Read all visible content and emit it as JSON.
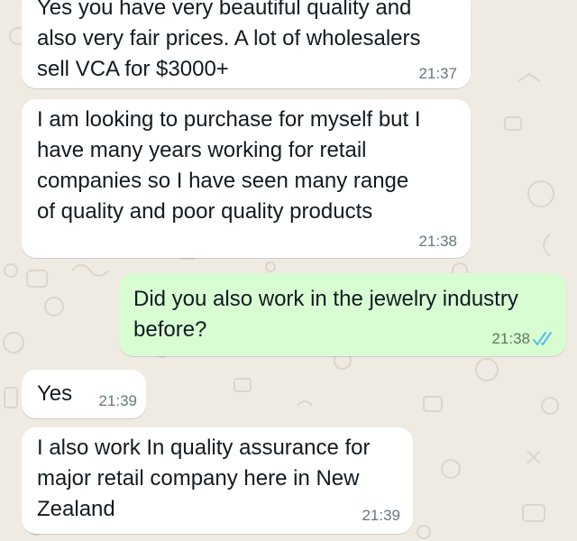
{
  "theme": {
    "wallpaper": "#efeae2",
    "incoming_bubble": "#ffffff",
    "outgoing_bubble": "#d9fdd3",
    "read_tick_color": "#53bdeb"
  },
  "messages": [
    {
      "direction": "incoming",
      "text": "Yes you have very beautiful quality and\nalso very fair prices. A lot of wholesalers\nsell VCA for $3000+",
      "time": "21:37"
    },
    {
      "direction": "incoming",
      "text": "I am looking to purchase for myself but I\nhave many years working for retail\ncompanies so I have seen many range\nof quality and poor quality products",
      "time": "21:38"
    },
    {
      "direction": "outgoing",
      "text": "Did you also work in the jewelry industry\nbefore?",
      "time": "21:38",
      "status_icon": "double-check-read-icon"
    },
    {
      "direction": "incoming",
      "text": "Yes",
      "time": "21:39"
    },
    {
      "direction": "incoming",
      "text": "I also work In quality assurance for\nmajor retail company here in New\nZealand",
      "time": "21:39"
    }
  ]
}
